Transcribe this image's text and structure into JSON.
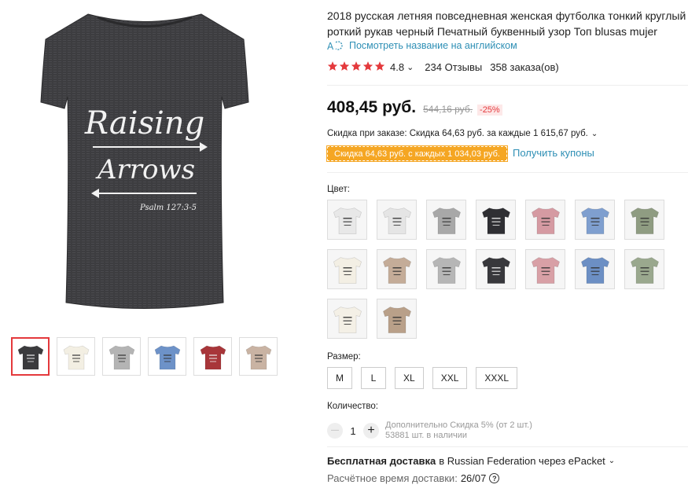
{
  "product": {
    "title_line1": "2018 русская летняя повседневная женская футболка тонкий круглый выр",
    "title_line2": "роткий рукав черный Печатный буквенный узор Топ blusas mujer",
    "translate_link": "Посмотреть название на английском",
    "rating": "4.8",
    "rating_chevron": "⌄",
    "reviews": "234 Отзывы",
    "orders": "358 заказа(ов)",
    "star_count": 5
  },
  "price": {
    "current": "408,45 руб.",
    "old": "544,16 руб.",
    "discount_pct": "-25%"
  },
  "discounts": {
    "order_discount": "Скидка при заказе: Скидка 64,63 руб. за каждые 1 615,67 руб.",
    "coupon_tag": "Скидка 64,63 руб. с каждых 1 034,03 руб.",
    "get_coupons": "Получить купоны"
  },
  "image_text": {
    "line1": "Raising",
    "line2": "Arrows",
    "verse": "Psalm 127:3-5"
  },
  "labels": {
    "color": "Цвет:",
    "size": "Размер:",
    "quantity": "Количество:"
  },
  "sizes": [
    "M",
    "L",
    "XL",
    "XXL",
    "XXXL"
  ],
  "colors": [
    "#e8e8e8",
    "#e5e5e5",
    "#a8a8a8",
    "#2f2f33",
    "#d59aa2",
    "#7f9fcf",
    "#8f9c82",
    "#f3efe4",
    "#c4ac98",
    "#b6b6b6",
    "#38383c",
    "#d8a0a6",
    "#6c8fc4",
    "#9aa88e",
    "#f4f0e6",
    "#b9a089"
  ],
  "thumb_colors": [
    "#3b3b3d",
    "#f3efe3",
    "#b4b4b4",
    "#6d92c8",
    "#a8363a",
    "#c9b3a3"
  ],
  "quantity": {
    "minus": "—",
    "value": "1",
    "plus": "+",
    "note_line1": "Дополнительно Скидка 5% (от 2 шт.)",
    "note_line2": "53881 шт. в наличии"
  },
  "shipping": {
    "free": "Бесплатная доставка",
    "rest": "в Russian Federation через ePacket",
    "chevron": "⌄",
    "delivery_label": "Расчётное время доставки:",
    "delivery_date": "26/07",
    "help_icon": "?"
  }
}
